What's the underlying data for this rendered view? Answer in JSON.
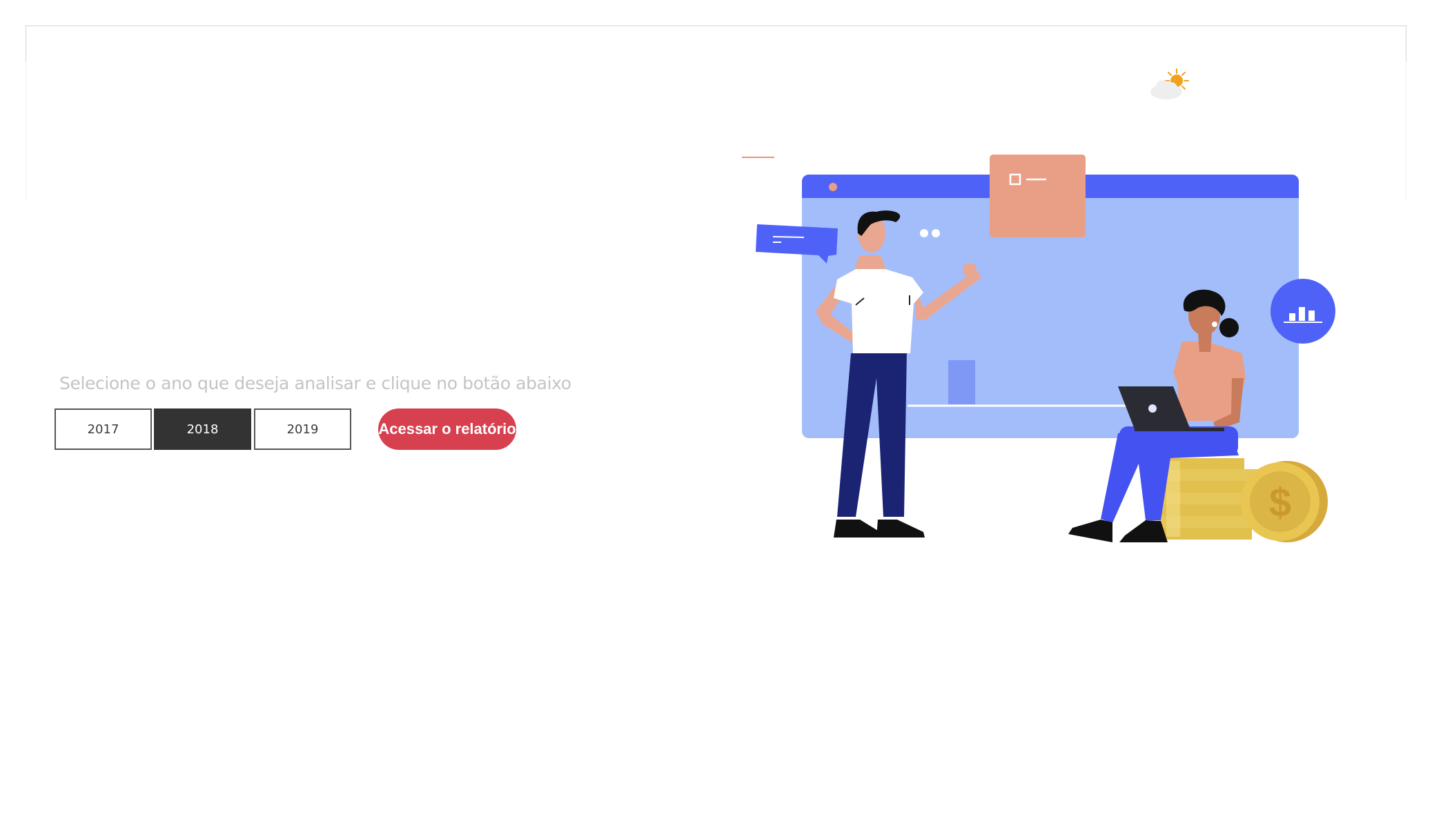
{
  "instruction": "Selecione o ano que deseja analisar e clique no botão abaixo",
  "years": [
    {
      "label": "2017",
      "selected": false
    },
    {
      "label": "2018",
      "selected": true
    },
    {
      "label": "2019",
      "selected": false
    }
  ],
  "report_button": "Acessar o relatório",
  "illustration_icons": [
    "weather-sun-cloud-icon",
    "bar-chart-icon",
    "dollar-coin-icon",
    "speech-bubble-icon",
    "laptop-icon"
  ],
  "colors": {
    "selected_year_bg": "#333333",
    "report_button_bg": "#d6404f",
    "instruction_text": "#c4c4c4",
    "browser_window": "#a3bdfa",
    "accent_blue": "#4f62f7",
    "salmon": "#e89f86",
    "coin_gold": "#e2c04e"
  }
}
